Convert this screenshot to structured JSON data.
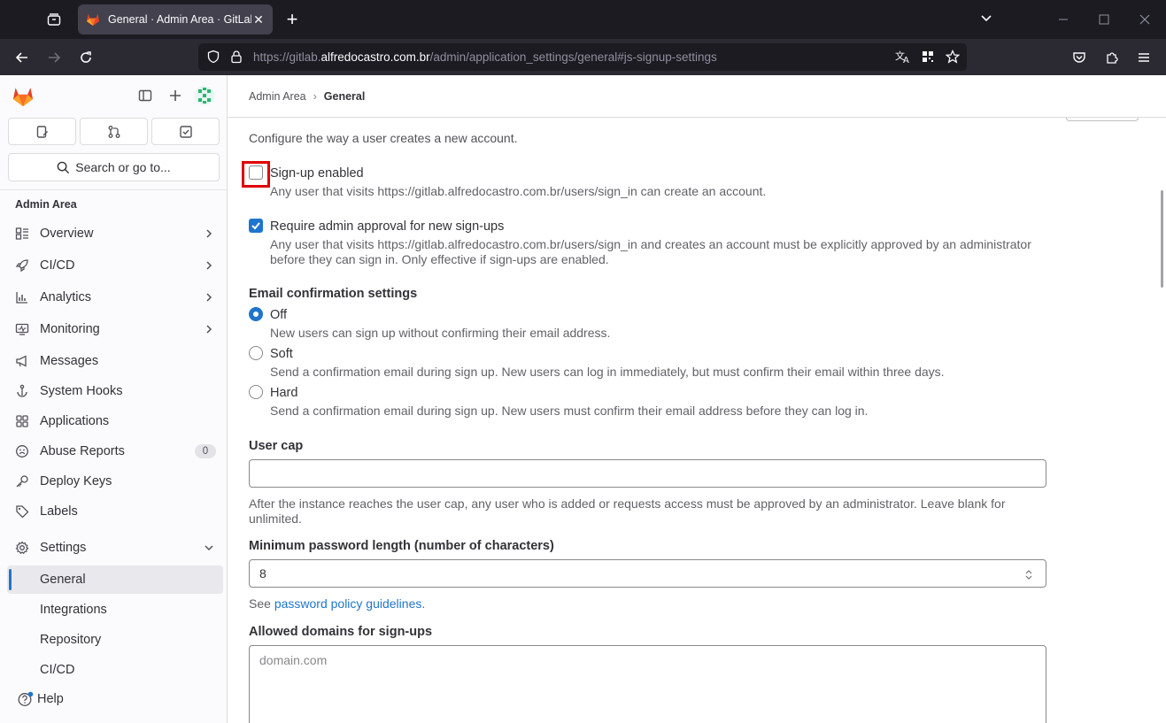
{
  "browser": {
    "tab_title": "General · Admin Area · GitLab",
    "url_prefix": "https://gitlab.",
    "url_host": "alfredocastro.com.br",
    "url_path": "/admin/application_settings/general#js-signup-settings"
  },
  "sidebar": {
    "search_label": "Search or go to...",
    "heading": "Admin Area",
    "items": [
      {
        "label": "Overview",
        "icon": "overview-icon"
      },
      {
        "label": "CI/CD",
        "icon": "rocket-icon"
      },
      {
        "label": "Analytics",
        "icon": "chart-icon"
      },
      {
        "label": "Monitoring",
        "icon": "monitor-icon"
      },
      {
        "label": "Messages",
        "icon": "megaphone-icon"
      },
      {
        "label": "System Hooks",
        "icon": "hook-icon"
      },
      {
        "label": "Applications",
        "icon": "applications-icon"
      },
      {
        "label": "Abuse Reports",
        "icon": "abuse-icon",
        "badge": "0"
      },
      {
        "label": "Deploy Keys",
        "icon": "key-icon"
      },
      {
        "label": "Labels",
        "icon": "label-icon"
      },
      {
        "label": "Settings",
        "icon": "gear-icon"
      }
    ],
    "settings_subitems": [
      "General",
      "Integrations",
      "Repository",
      "CI/CD"
    ],
    "help_label": "Help"
  },
  "breadcrumb": {
    "parent": "Admin Area",
    "current": "General"
  },
  "signup": {
    "intro": "Configure the way a user creates a new account.",
    "signup_enabled": {
      "label": "Sign-up enabled",
      "help": "Any user that visits https://gitlab.alfredocastro.com.br/users/sign_in can create an account.",
      "checked": false
    },
    "admin_approval": {
      "label": "Require admin approval for new sign-ups",
      "help": "Any user that visits https://gitlab.alfredocastro.com.br/users/sign_in and creates an account must be explicitly approved by an administrator before they can sign in. Only effective if sign-ups are enabled.",
      "checked": true
    },
    "email_confirmation": {
      "label": "Email confirmation settings",
      "selected": "Off",
      "options": [
        {
          "label": "Off",
          "help": "New users can sign up without confirming their email address."
        },
        {
          "label": "Soft",
          "help": "Send a confirmation email during sign up. New users can log in immediately, but must confirm their email within three days."
        },
        {
          "label": "Hard",
          "help": "Send a confirmation email during sign up. New users must confirm their email address before they can log in."
        }
      ]
    },
    "user_cap": {
      "label": "User cap",
      "value": "",
      "help": "After the instance reaches the user cap, any user who is added or requests access must be approved by an administrator. Leave blank for unlimited."
    },
    "min_password": {
      "label": "Minimum password length (number of characters)",
      "value": "8",
      "help_prefix": "See ",
      "help_link": "password policy guidelines",
      "help_suffix": "."
    },
    "allowed_domains": {
      "label": "Allowed domains for sign-ups",
      "placeholder": "domain.com"
    }
  },
  "colors": {
    "accent": "#1f75cb",
    "focus_highlight": "#e00000"
  }
}
